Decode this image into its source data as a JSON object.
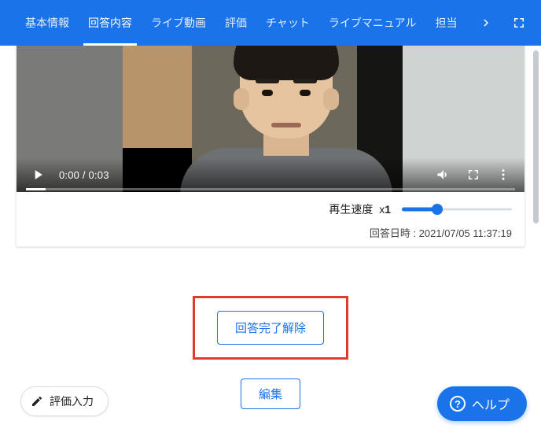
{
  "tabs": {
    "items": [
      {
        "label": "基本情報"
      },
      {
        "label": "回答内容"
      },
      {
        "label": "ライブ動画"
      },
      {
        "label": "評価"
      },
      {
        "label": "チャット"
      },
      {
        "label": "ライブマニュアル"
      },
      {
        "label": "担当"
      }
    ],
    "active_index": 1
  },
  "video": {
    "current_time": "0:00",
    "duration": "0:03",
    "time_separator": " / "
  },
  "speed": {
    "label": "再生速度",
    "value_prefix": "x",
    "value": "1"
  },
  "answered_at": {
    "label": "回答日時 : ",
    "value": "2021/07/05 11:37:19"
  },
  "buttons": {
    "unlock": "回答完了解除",
    "edit": "編集"
  },
  "floating": {
    "eval_input": "評価入力",
    "help": "ヘルプ"
  },
  "icons": {
    "chevron_right": "chevron-right-icon",
    "fullscreen": "fullscreen-icon",
    "play": "play-icon",
    "volume": "volume-icon",
    "video_fullscreen": "video-fullscreen-icon",
    "more": "more-vert-icon",
    "pencil": "pencil-icon",
    "question": "question-icon"
  }
}
